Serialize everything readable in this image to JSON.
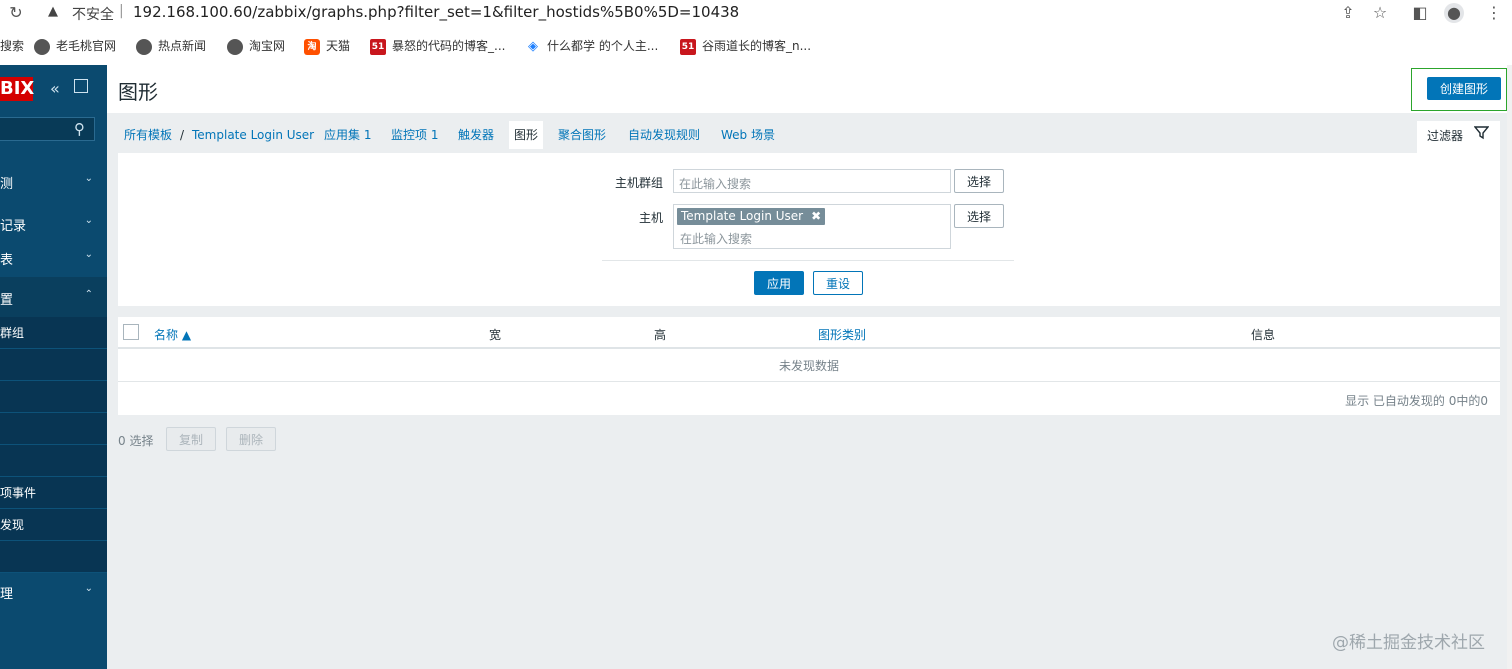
{
  "browser": {
    "reload_icon": "↻",
    "warning_icon": "▲",
    "insecure_label": "不安全",
    "separator": "|",
    "url": "192.168.100.60/zabbix/graphs.php?filter_set=1&filter_hostids%5B0%5D=10438",
    "icons": [
      "share-icon",
      "star-icon",
      "sidepanel-icon",
      "profile-icon",
      "menu-icon"
    ],
    "bookmarks": [
      {
        "label": "搜索",
        "icon": "none"
      },
      {
        "label": "老毛桃官网",
        "icon": "globe"
      },
      {
        "label": "热点新闻",
        "icon": "globe"
      },
      {
        "label": "淘宝网",
        "icon": "globe"
      },
      {
        "label": "天猫",
        "icon": "tao"
      },
      {
        "label": "暴怒的代码的博客_...",
        "icon": "red51"
      },
      {
        "label": "什么都学 的个人主...",
        "icon": "blue"
      },
      {
        "label": "谷雨道长的博客_n...",
        "icon": "red51"
      }
    ]
  },
  "sidebar": {
    "logo": "BIX",
    "collapse_icon": "«",
    "nav": [
      {
        "label": "测",
        "chev": "⌄"
      },
      {
        "label": "记录",
        "chev": "⌄"
      },
      {
        "label": "表",
        "chev": "⌄"
      },
      {
        "label": "置",
        "chev": "⌃"
      }
    ],
    "sub": [
      "群组",
      "",
      "",
      "",
      "",
      "项事件",
      "发现",
      ""
    ],
    "admin": {
      "label": "理",
      "chev": "⌄"
    }
  },
  "header": {
    "title": "图形",
    "create_label": "创建图形"
  },
  "tabs": [
    {
      "label": "所有模板"
    },
    {
      "label": "/"
    },
    {
      "label": "Template Login User"
    },
    {
      "label": "应用集 1"
    },
    {
      "label": "监控项 1"
    },
    {
      "label": "触发器"
    },
    {
      "label": "图形",
      "active": true
    },
    {
      "label": "聚合图形"
    },
    {
      "label": "自动发现规则"
    },
    {
      "label": "Web 场景"
    }
  ],
  "filter": {
    "tab_label": "过滤器",
    "host_group_label": "主机群组",
    "host_group_placeholder": "在此输入搜索",
    "select_label": "选择",
    "host_label": "主机",
    "host_tag": "Template Login User",
    "tag_remove": "✖",
    "host_placeholder": "在此输入搜索",
    "apply_label": "应用",
    "reset_label": "重设"
  },
  "table": {
    "columns": [
      "名称 ▲",
      "宽",
      "高",
      "图形类别",
      "信息"
    ],
    "empty_message": "未发现数据",
    "pager_info": "显示 已自动发现的 0中的0"
  },
  "footer": {
    "selected_count": "0 选择",
    "copy_label": "复制",
    "delete_label": "删除"
  },
  "watermark": "@稀土掘金技术社区",
  "colors": {
    "accent": "#0275b8",
    "sidebar": "#0b4a6f",
    "logo": "#d40000",
    "highlight": "#2ca52c"
  }
}
